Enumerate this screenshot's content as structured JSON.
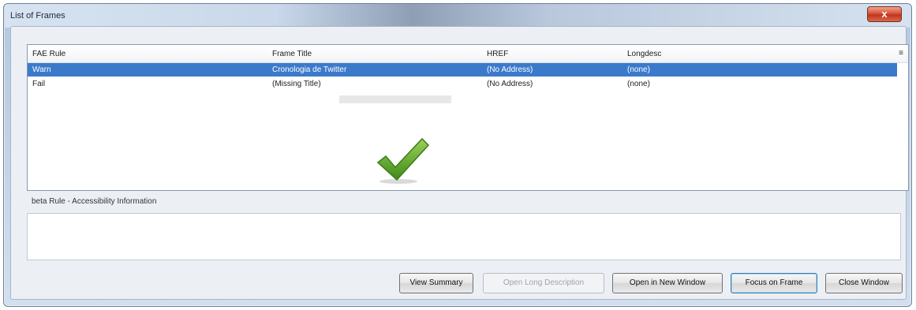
{
  "window": {
    "title": "List of Frames",
    "close_label": "x"
  },
  "columns": [
    "FAE Rule",
    "Frame Title",
    "HREF",
    "Longdesc"
  ],
  "rows": [
    {
      "rule": "Warn",
      "title": "Cronologia de Twitter",
      "href": "(No Address)",
      "longdesc": "(none)",
      "selected": true
    },
    {
      "rule": "Fail",
      "title": "(Missing Title)",
      "href": "(No Address)",
      "longdesc": "(none)",
      "selected": false
    }
  ],
  "column_picker": "≡",
  "info": {
    "label": "beta Rule - Accessibility Information",
    "text": ""
  },
  "buttons": {
    "view_summary": "View Summary",
    "open_long_description": "Open Long Description",
    "open_in_new_window": "Open in New Window",
    "focus_on_frame": "Focus on Frame",
    "close_window": "Close Window"
  },
  "icons": {
    "checkmark": "checkmark-icon"
  },
  "colors": {
    "selection": "#3b7acb",
    "check": "#5aa82a"
  }
}
